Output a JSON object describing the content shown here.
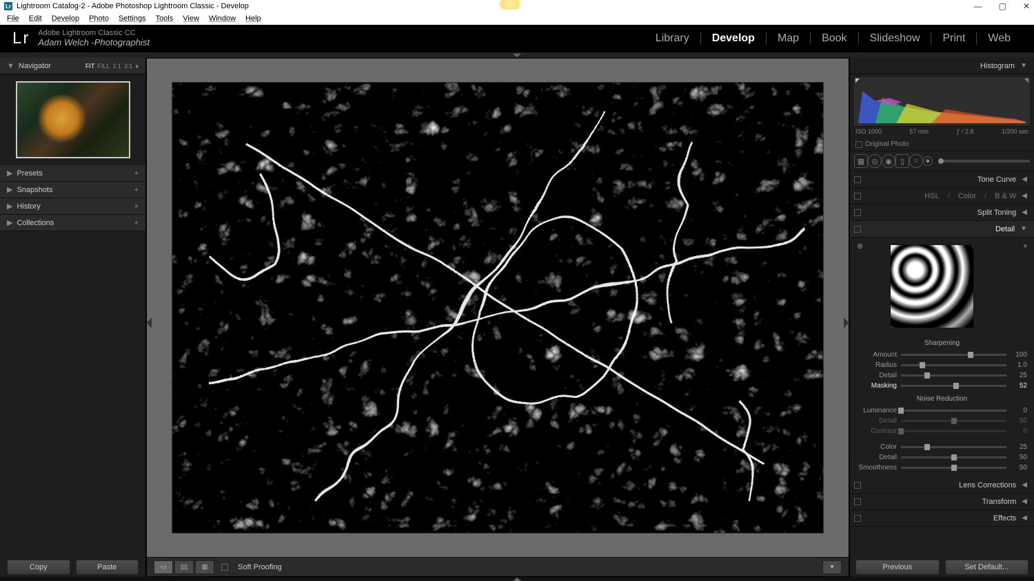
{
  "window": {
    "title": "Lightroom Catalog-2 - Adobe Photoshop Lightroom Classic - Develop"
  },
  "menu": {
    "items": [
      "File",
      "Edit",
      "Develop",
      "Photo",
      "Settings",
      "Tools",
      "View",
      "Window",
      "Help"
    ]
  },
  "identity": {
    "app": "Lr",
    "product": "Adobe Lightroom Classic CC",
    "owner": "Adam Welch -Photographist"
  },
  "modules": {
    "items": [
      "Library",
      "Develop",
      "Map",
      "Book",
      "Slideshow",
      "Print",
      "Web"
    ],
    "active": "Develop"
  },
  "left": {
    "navigator": {
      "title": "Navigator",
      "opts": [
        "FIT",
        "FILL",
        "1:1",
        "3:1"
      ],
      "active": "FIT"
    },
    "panels": [
      {
        "title": "Presets",
        "action": "+"
      },
      {
        "title": "Snapshots",
        "action": "+"
      },
      {
        "title": "History",
        "action": "×"
      },
      {
        "title": "Collections",
        "action": "+"
      }
    ],
    "copy": "Copy",
    "paste": "Paste"
  },
  "bottom": {
    "softproof": "Soft Proofing"
  },
  "right": {
    "histogram": {
      "title": "Histogram",
      "iso": "ISO 1000",
      "focal": "57 mm",
      "aperture": "ƒ / 2.8",
      "shutter": "1/200 sec",
      "original": "Original Photo"
    },
    "panels": {
      "tonecurve": "Tone Curve",
      "hsl": {
        "hsl": "HSL",
        "color": "Color",
        "bw": "B & W"
      },
      "splittoning": "Split Toning",
      "detail": "Detail",
      "lenscorr": "Lens Corrections",
      "transform": "Transform",
      "effects": "Effects"
    },
    "sharpening": {
      "title": "Sharpening",
      "rows": [
        {
          "label": "Amount",
          "value": 100,
          "pos": 66,
          "hl": false
        },
        {
          "label": "Radius",
          "value": "1.0",
          "pos": 20,
          "hl": false
        },
        {
          "label": "Detail",
          "value": 25,
          "pos": 25,
          "hl": false
        },
        {
          "label": "Masking",
          "value": 52,
          "pos": 52,
          "hl": true
        }
      ]
    },
    "noise": {
      "title": "Noise Reduction",
      "rows1": [
        {
          "label": "Luminance",
          "value": 0,
          "pos": 0,
          "hl": false
        },
        {
          "label": "Detail",
          "value": 50,
          "pos": 50,
          "hl": false,
          "dim": true
        },
        {
          "label": "Contrast",
          "value": 0,
          "pos": 0,
          "hl": false,
          "dim": true
        }
      ],
      "rows2": [
        {
          "label": "Color",
          "value": 25,
          "pos": 25,
          "hl": false
        },
        {
          "label": "Detail",
          "value": 50,
          "pos": 50,
          "hl": false
        },
        {
          "label": "Smoothness",
          "value": 50,
          "pos": 50,
          "hl": false
        }
      ]
    },
    "previous": "Previous",
    "reset": "Set Default..."
  }
}
